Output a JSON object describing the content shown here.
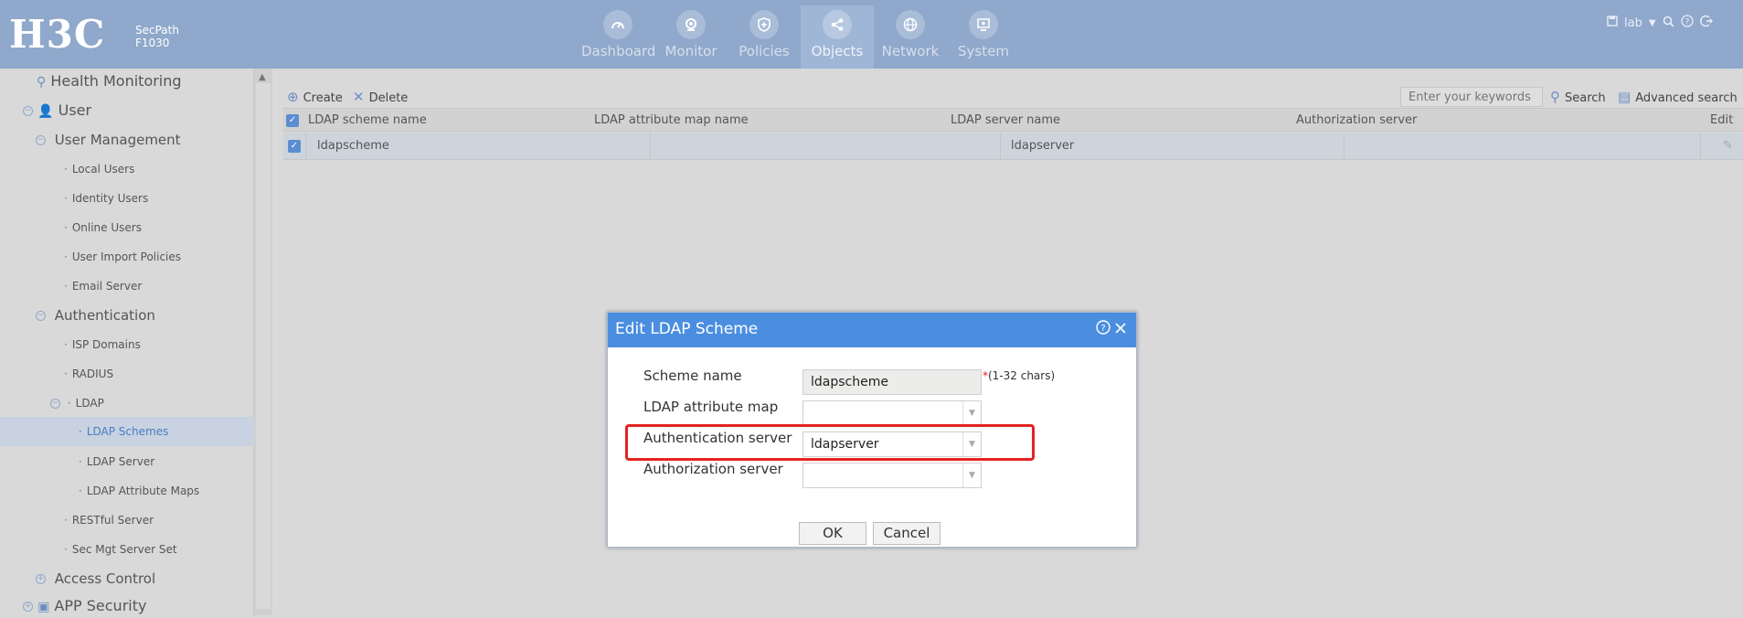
{
  "header": {
    "logo": "H3C",
    "model_line1": "SecPath",
    "model_line2": "F1030",
    "nav": [
      {
        "label": "Dashboard",
        "icon": "gauge-icon"
      },
      {
        "label": "Monitor",
        "icon": "monitor-icon"
      },
      {
        "label": "Policies",
        "icon": "shield-icon"
      },
      {
        "label": "Objects",
        "icon": "share-icon",
        "active": true
      },
      {
        "label": "Network",
        "icon": "globe-icon"
      },
      {
        "label": "System",
        "icon": "computer-icon"
      }
    ],
    "user": "lab"
  },
  "sidebar": {
    "items": [
      {
        "label": "Health Monitoring"
      },
      {
        "label": "User"
      },
      {
        "label": "User Management"
      },
      {
        "label": "Local Users"
      },
      {
        "label": "Identity Users"
      },
      {
        "label": "Online Users"
      },
      {
        "label": "User Import Policies"
      },
      {
        "label": "Email Server"
      },
      {
        "label": "Authentication"
      },
      {
        "label": "ISP Domains"
      },
      {
        "label": "RADIUS"
      },
      {
        "label": "LDAP"
      },
      {
        "label": "LDAP Schemes",
        "selected": true
      },
      {
        "label": "LDAP Server"
      },
      {
        "label": "LDAP Attribute Maps"
      },
      {
        "label": "RESTful Server"
      },
      {
        "label": "Sec Mgt Server Set"
      },
      {
        "label": "Access Control"
      },
      {
        "label": "APP Security"
      }
    ]
  },
  "toolbar": {
    "create_label": "Create",
    "delete_label": "Delete",
    "search_placeholder": "Enter your keywords",
    "search_label": "Search",
    "advanced_label": "Advanced search"
  },
  "table": {
    "columns": [
      "LDAP scheme name",
      "LDAP attribute map name",
      "LDAP server name",
      "Authorization server",
      "Edit"
    ],
    "rows": [
      {
        "scheme": "ldapscheme",
        "attr_map": "",
        "server": "ldapserver",
        "authz": ""
      }
    ]
  },
  "modal": {
    "title": "Edit LDAP Scheme",
    "fields": {
      "scheme_name": {
        "label": "Scheme name",
        "value": "ldapscheme",
        "hint_req": "*",
        "hint": "(1-32 chars)"
      },
      "attr_map": {
        "label": "LDAP attribute map",
        "value": ""
      },
      "auth_server": {
        "label": "Authentication server",
        "value": "ldapserver"
      },
      "authz_server": {
        "label": "Authorization server",
        "value": ""
      }
    },
    "ok_label": "OK",
    "cancel_label": "Cancel"
  },
  "colors": {
    "header": "#8fa8cb",
    "modal_head": "#4b8ee0",
    "highlight": "#e52222",
    "accent": "#5b8dd0"
  }
}
